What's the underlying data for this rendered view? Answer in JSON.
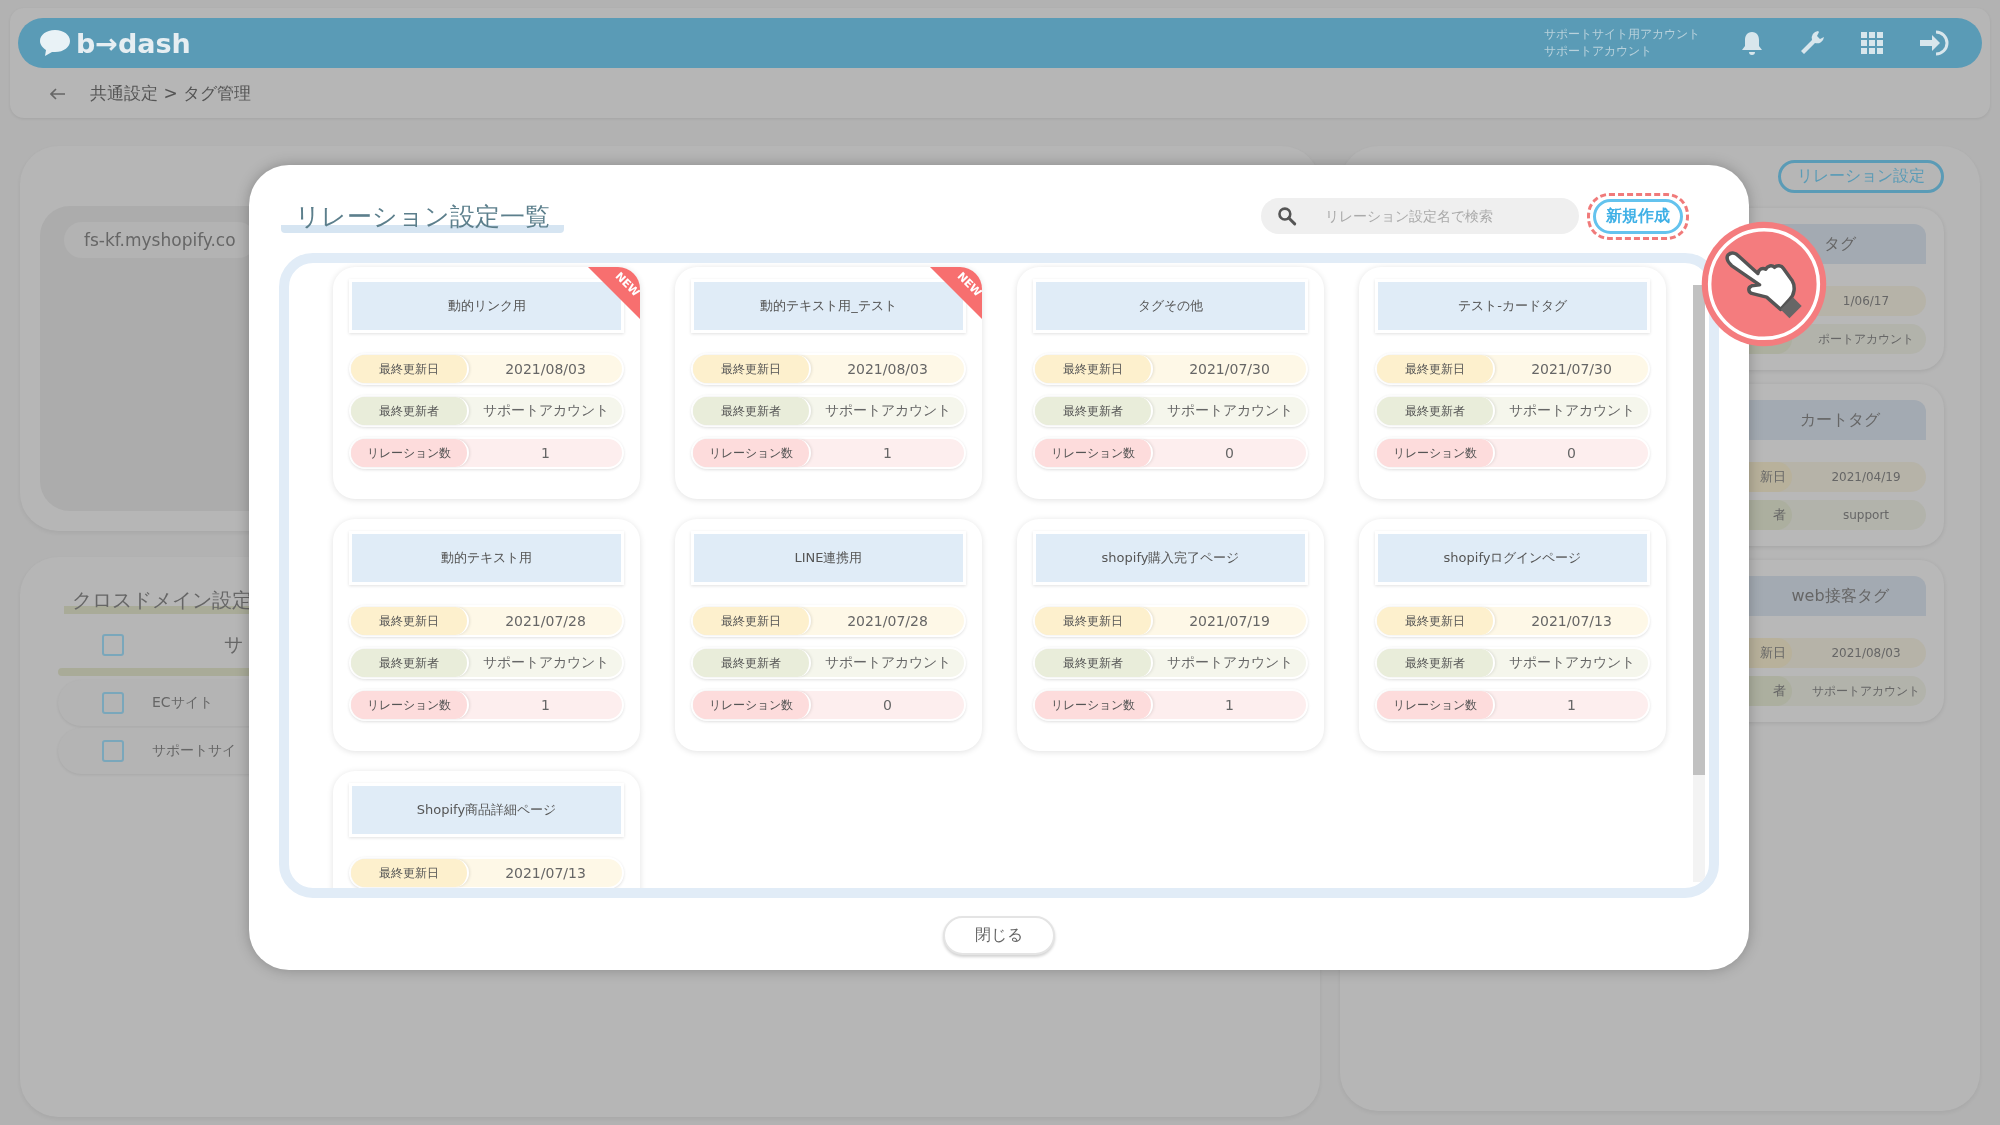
{
  "header": {
    "logo": "b→dash",
    "account_line1": "サポートサイト用アカウント",
    "account_line2": "サポートアカウント"
  },
  "breadcrumb": "共通設定 > タグ管理",
  "background": {
    "domain": "fs-kf.myshopify.co",
    "cross_domain": {
      "title": "クロスドメイン設定",
      "header_column": "サ",
      "header_checked": false,
      "rows": [
        {
          "name": "ECサイト",
          "checked": false
        },
        {
          "name": "サポートサイ",
          "checked": false
        }
      ]
    },
    "relation_button": "リレーション設定",
    "tag_cards": [
      {
        "title": "タグ",
        "rows": [
          {
            "kind": "date",
            "value": "1/06/17"
          },
          {
            "kind": "author",
            "value": "ポートアカウント"
          }
        ]
      },
      {
        "title": "カートタグ",
        "rows": [
          {
            "kind": "date",
            "label": "新日",
            "value": "2021/04/19"
          },
          {
            "kind": "author",
            "label": "者",
            "value": "support"
          }
        ]
      },
      {
        "title": "web接客タグ",
        "rows": [
          {
            "kind": "date",
            "label": "新日",
            "value": "2021/08/03"
          },
          {
            "kind": "author",
            "label": "者",
            "value": "サポートアカウント"
          }
        ]
      }
    ]
  },
  "modal": {
    "title": "リレーション設定一覧",
    "search": {
      "placeholder": "リレーション設定名で検索"
    },
    "create_button": "新規作成",
    "close_button": "閉じる",
    "cards": [
      {
        "title": "動的リンク用",
        "badge": "NEW",
        "rows": [
          {
            "kind": "date",
            "label": "最終更新日",
            "value": "2021/08/03"
          },
          {
            "kind": "author",
            "label": "最終更新者",
            "value": "サポートアカウント"
          },
          {
            "kind": "count",
            "label": "リレーション数",
            "value": "1"
          }
        ]
      },
      {
        "title": "動的テキスト用_テスト",
        "badge": "NEW",
        "rows": [
          {
            "kind": "date",
            "label": "最終更新日",
            "value": "2021/08/03"
          },
          {
            "kind": "author",
            "label": "最終更新者",
            "value": "サポートアカウント"
          },
          {
            "kind": "count",
            "label": "リレーション数",
            "value": "1"
          }
        ]
      },
      {
        "title": "タグその他",
        "rows": [
          {
            "kind": "date",
            "label": "最終更新日",
            "value": "2021/07/30"
          },
          {
            "kind": "author",
            "label": "最終更新者",
            "value": "サポートアカウント"
          },
          {
            "kind": "count",
            "label": "リレーション数",
            "value": "0"
          }
        ]
      },
      {
        "title": "テスト-カードタグ",
        "rows": [
          {
            "kind": "date",
            "label": "最終更新日",
            "value": "2021/07/30"
          },
          {
            "kind": "author",
            "label": "最終更新者",
            "value": "サポートアカウント"
          },
          {
            "kind": "count",
            "label": "リレーション数",
            "value": "0"
          }
        ]
      },
      {
        "title": "動的テキスト用",
        "rows": [
          {
            "kind": "date",
            "label": "最終更新日",
            "value": "2021/07/28"
          },
          {
            "kind": "author",
            "label": "最終更新者",
            "value": "サポートアカウント"
          },
          {
            "kind": "count",
            "label": "リレーション数",
            "value": "1"
          }
        ]
      },
      {
        "title": "LINE連携用",
        "rows": [
          {
            "kind": "date",
            "label": "最終更新日",
            "value": "2021/07/28"
          },
          {
            "kind": "author",
            "label": "最終更新者",
            "value": "サポートアカウント"
          },
          {
            "kind": "count",
            "label": "リレーション数",
            "value": "0"
          }
        ]
      },
      {
        "title": "shopify購入完了ページ",
        "rows": [
          {
            "kind": "date",
            "label": "最終更新日",
            "value": "2021/07/19"
          },
          {
            "kind": "author",
            "label": "最終更新者",
            "value": "サポートアカウント"
          },
          {
            "kind": "count",
            "label": "リレーション数",
            "value": "1"
          }
        ]
      },
      {
        "title": "shopifyログインページ",
        "rows": [
          {
            "kind": "date",
            "label": "最終更新日",
            "value": "2021/07/13"
          },
          {
            "kind": "author",
            "label": "最終更新者",
            "value": "サポートアカウント"
          },
          {
            "kind": "count",
            "label": "リレーション数",
            "value": "1"
          }
        ]
      },
      {
        "title": "Shopify商品詳細ページ",
        "rows": [
          {
            "kind": "date",
            "label": "最終更新日",
            "value": "2021/07/13"
          }
        ]
      }
    ]
  }
}
